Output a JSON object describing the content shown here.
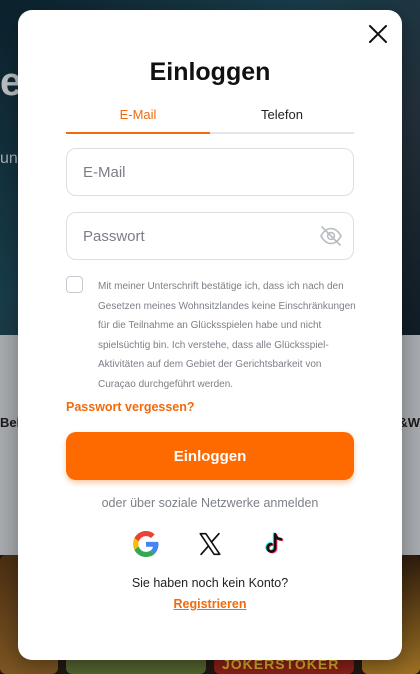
{
  "background": {
    "hero_text_large": "er",
    "hero_text_small": "une",
    "mid_label_left": "Bel",
    "mid_label_right": "&W",
    "tile_text": "JOKERSTOKER"
  },
  "modal": {
    "title": "Einloggen",
    "close_icon": "close-icon",
    "tabs": [
      {
        "label": "E-Mail",
        "active": true
      },
      {
        "label": "Telefon",
        "active": false
      }
    ],
    "email": {
      "placeholder": "E-Mail",
      "value": ""
    },
    "password": {
      "placeholder": "Passwort",
      "value": "",
      "toggle_icon": "eye-off-icon"
    },
    "consent_checked": false,
    "consent_text": "Mit meiner Unterschrift bestätige ich, dass ich nach den Gesetzen meines Wohnsitzlandes keine Einschränkungen für die Teilnahme an Glücksspielen habe und nicht spielsüchtig bin. Ich verstehe, dass alle Glücksspiel-Aktivitäten auf dem Gebiet der Gerichtsbarkeit von Curaçao durchgeführt werden.",
    "forgot_password": "Passwort vergessen?",
    "login_button": "Einloggen",
    "social_text": "oder über soziale Netzwerke anmelden",
    "social_providers": [
      "google-icon",
      "x-icon",
      "tiktok-icon"
    ],
    "no_account_text": "Sie haben noch kein Konto?",
    "register_link": "Registrieren"
  },
  "colors": {
    "accent": "#f26a0c",
    "button": "#ff6a00",
    "text_muted": "#7c8087"
  }
}
